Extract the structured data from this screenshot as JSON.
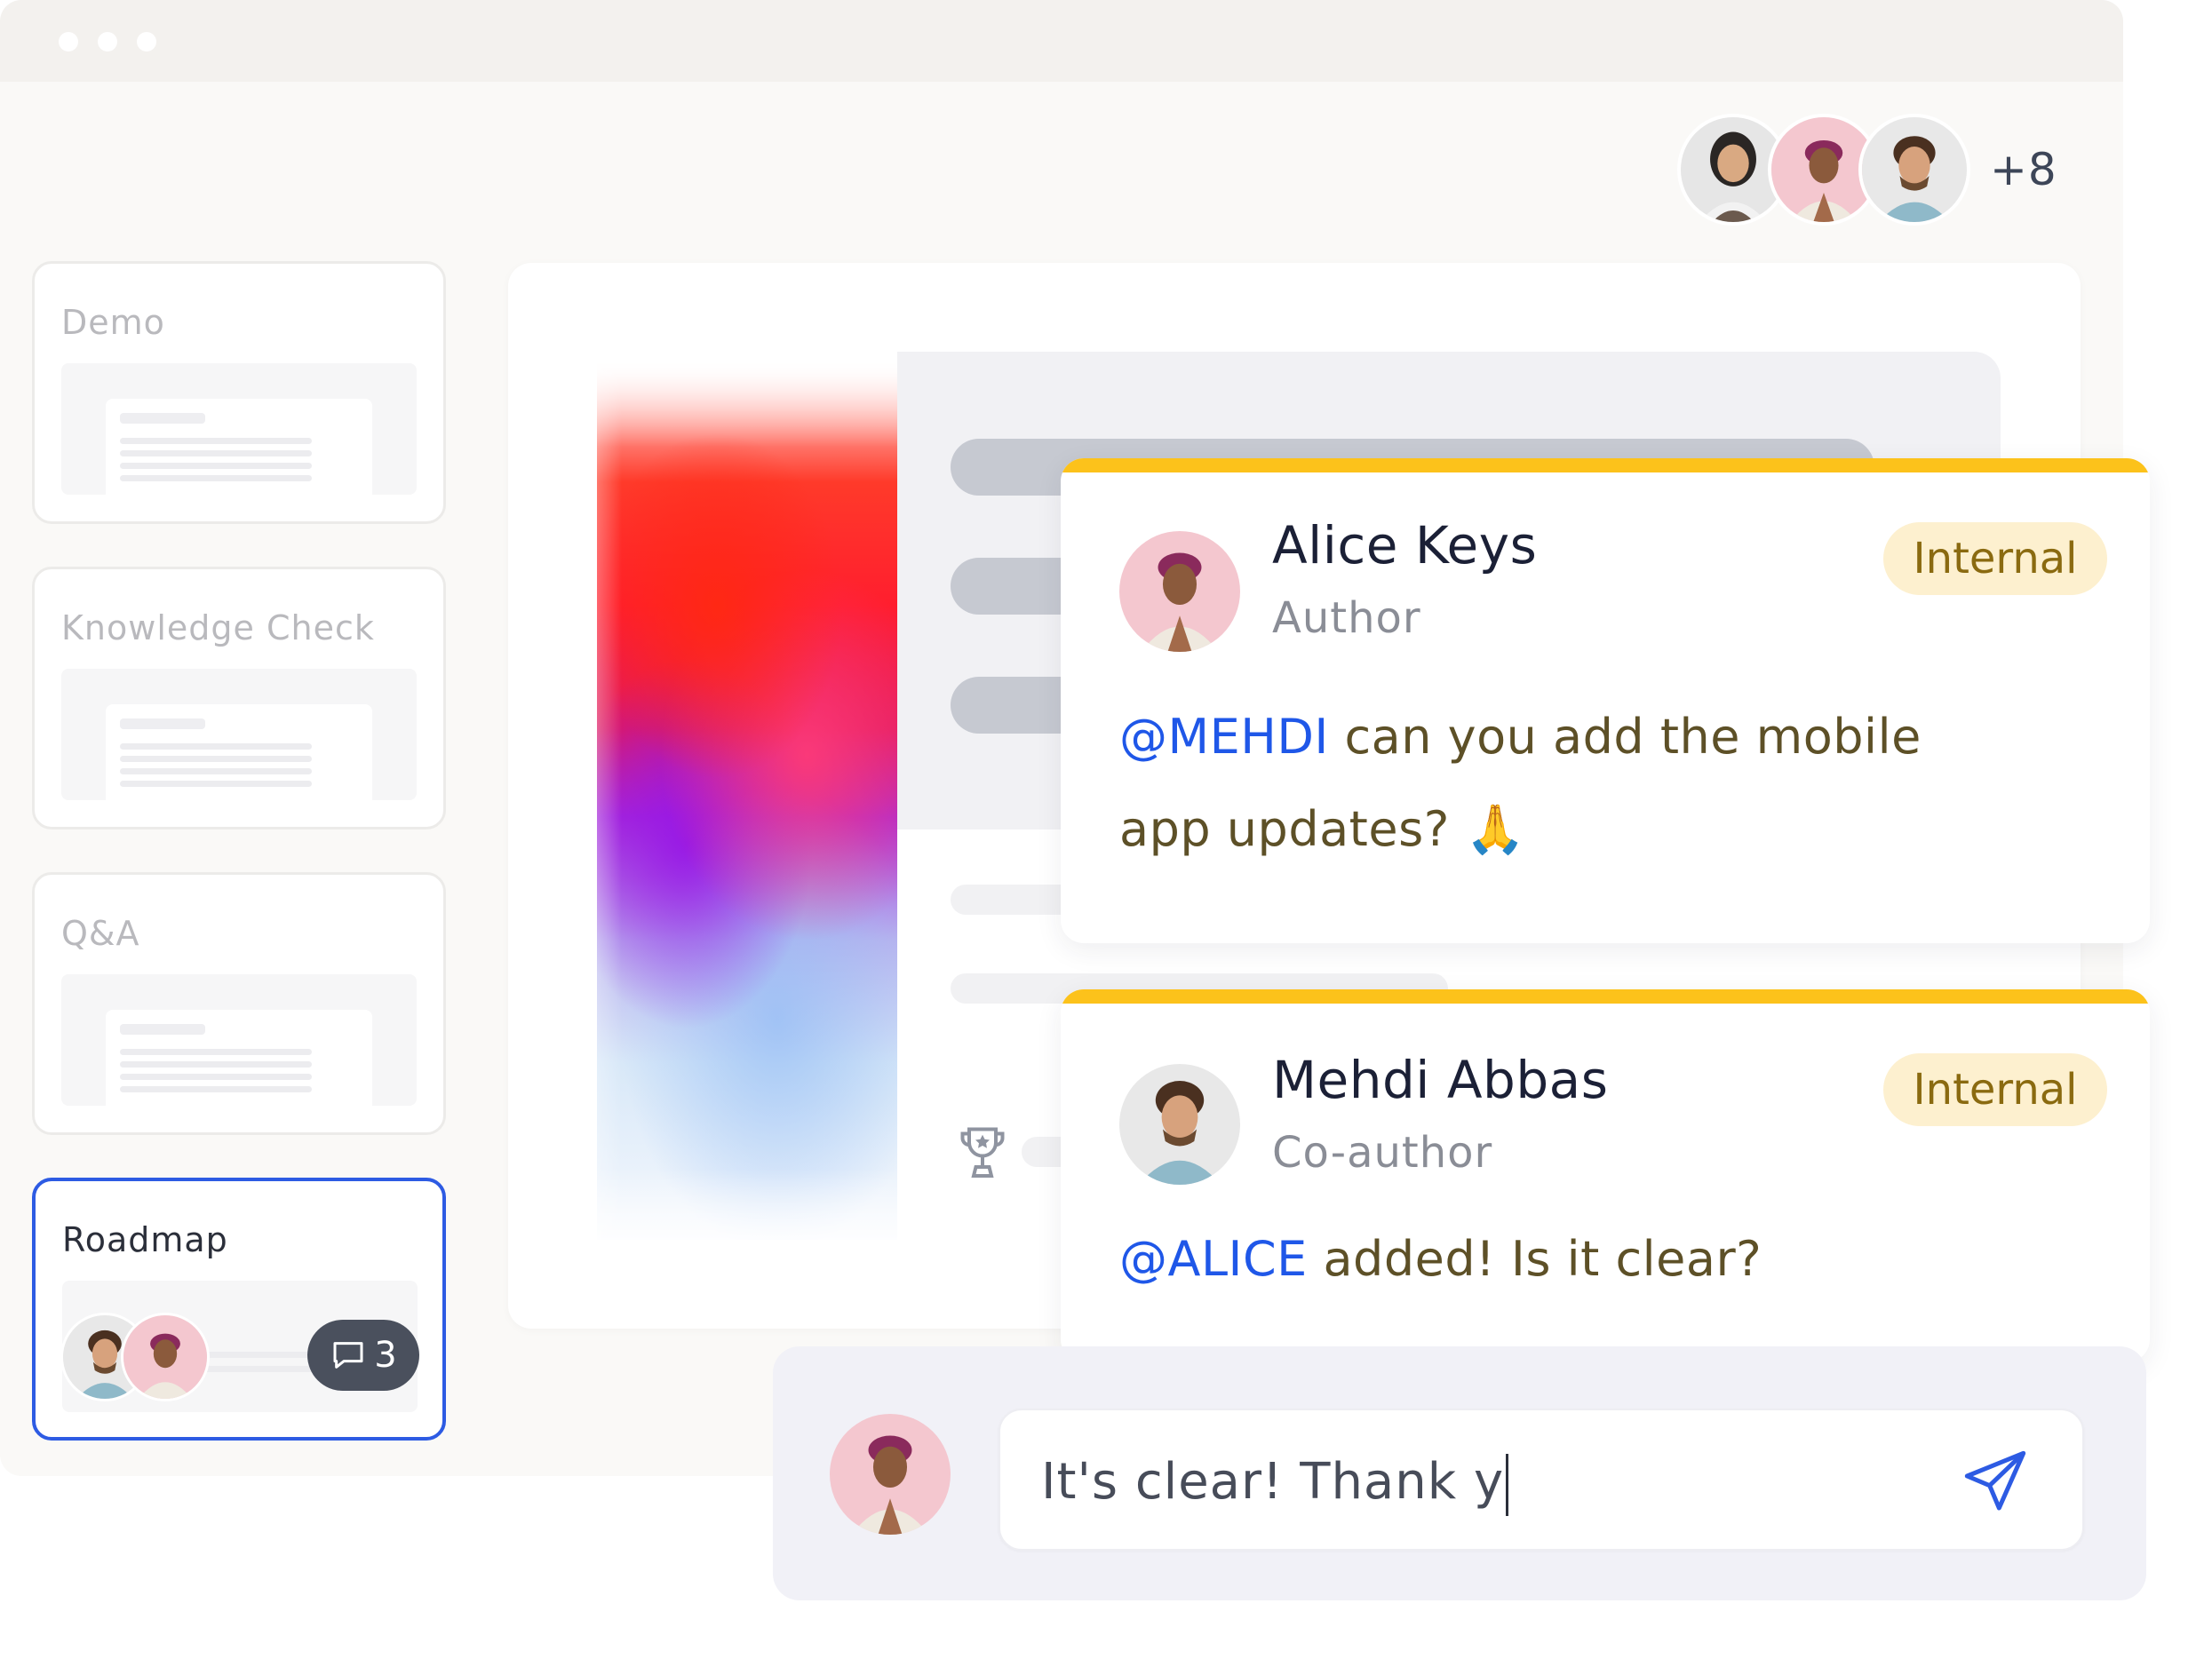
{
  "header": {
    "participants": [
      "participant-1",
      "participant-2",
      "participant-3"
    ],
    "more_count": "+8"
  },
  "sidebar": {
    "slides": [
      {
        "title": "Demo",
        "active": false
      },
      {
        "title": "Knowledge Check",
        "active": false
      },
      {
        "title": "Q&A",
        "active": false
      },
      {
        "title": "Roadmap",
        "active": true,
        "comment_count": "3"
      }
    ]
  },
  "comments": [
    {
      "name": "Alice Keys",
      "role": "Author",
      "tag": "Internal",
      "mention": "@MEHDI",
      "text_line1": " can you add the mobile",
      "text_line2": "app updates? 🙏"
    },
    {
      "name": "Mehdi Abbas",
      "role": "Co-author",
      "tag": "Internal",
      "mention": "@ALICE",
      "text_line1": " added! Is it clear?"
    }
  ],
  "composer": {
    "value": "It's clear! Thank y"
  },
  "colors": {
    "accent_blue": "#2d5be3",
    "mention_blue": "#1f57e8",
    "comment_bar_yellow": "#fcc21b",
    "internal_tag_bg": "#fdf0cf"
  },
  "icons": [
    "trophy-icon",
    "comment-icon",
    "send-icon"
  ]
}
